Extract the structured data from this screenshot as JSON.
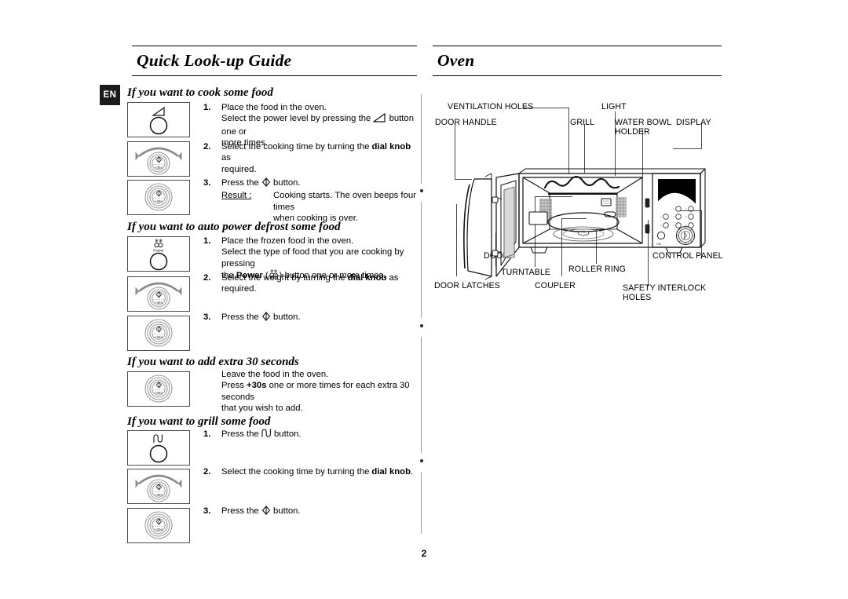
{
  "page_number": "2",
  "language_badge": "EN",
  "columns": {
    "left_title": "Quick Look-up Guide",
    "right_title": "Oven"
  },
  "sections": [
    {
      "id": "cook",
      "heading": "If you want to cook some food",
      "steps": [
        {
          "num": "1.",
          "icon": "power-level-button",
          "lines": [
            "Place the food in the oven.",
            "Select the power level by pressing the [power-icon] button one or more times."
          ],
          "text_a": "Place the food in the oven.",
          "text_b_pre": "Select the power level by pressing the",
          "text_b_post": "button one or",
          "text_c": "more times."
        },
        {
          "num": "2.",
          "icon": "dial-knob-turn",
          "text_pre": "Select the cooking time by turning the",
          "text_bold": "dial knob",
          "text_post": "as",
          "text_next": "required."
        },
        {
          "num": "3.",
          "icon": "dial-knob-press",
          "text_pre": "Press the",
          "text_post": "button.",
          "result_label": "Result :",
          "result_line1": "Cooking starts. The oven beeps four times",
          "result_line2": "when cooking is over."
        }
      ]
    },
    {
      "id": "defrost",
      "heading": "If you want to auto power defrost some food",
      "steps": [
        {
          "num": "1.",
          "icon": "power-defrost-button",
          "text_a": "Place the frozen food in the oven.",
          "text_b": "Select the type of food that you are cooking by pressing",
          "text_c_pre": "the",
          "text_c_bold": "Power",
          "text_c_paren_open": "(",
          "text_c_paren_close": ")",
          "text_c_post": "button one or more times."
        },
        {
          "num": "2.",
          "icon": "dial-knob-turn",
          "text_pre": "Select the weight by turning the",
          "text_bold": "dial knob",
          "text_post": "as required."
        },
        {
          "num": "3.",
          "icon": "dial-knob-press",
          "text_pre": "Press the",
          "text_post": "button."
        }
      ]
    },
    {
      "id": "extra30",
      "heading": "If you want to add extra 30 seconds",
      "steps": [
        {
          "num": "",
          "icon": "dial-knob-press",
          "text_a": "Leave the food in the oven.",
          "text_b_pre": "Press",
          "text_b_bold": "+30s",
          "text_b_post": "one or more times for each extra 30 seconds",
          "text_c": "that you wish to add."
        }
      ]
    },
    {
      "id": "grill",
      "heading": "If you want to grill some food",
      "steps": [
        {
          "num": "1.",
          "icon": "grill-button",
          "text_pre": "Press the",
          "text_post": "button."
        },
        {
          "num": "2.",
          "icon": "dial-knob-turn",
          "text_pre": "Select the cooking time by turning the",
          "text_bold": "dial knob",
          "text_post": "."
        },
        {
          "num": "3.",
          "icon": "dial-knob-press",
          "text_pre": "Press the",
          "text_post": "button."
        }
      ]
    }
  ],
  "diagram": {
    "name": "microwave-oven-exploded-view",
    "labels": [
      {
        "id": "ventilation-holes",
        "text": "VENTILATION HOLES"
      },
      {
        "id": "light",
        "text": "LIGHT"
      },
      {
        "id": "grill",
        "text": "GRILL"
      },
      {
        "id": "water-bowl-holder-line1",
        "text": "WATER BOWL"
      },
      {
        "id": "water-bowl-holder-line2",
        "text": "HOLDER"
      },
      {
        "id": "display",
        "text": "DISPLAY"
      },
      {
        "id": "door-handle",
        "text": "DOOR HANDLE"
      },
      {
        "id": "door",
        "text": "DOOR"
      },
      {
        "id": "turntable",
        "text": "TURNTABLE"
      },
      {
        "id": "roller-ring",
        "text": "ROLLER RING"
      },
      {
        "id": "control-panel",
        "text": "CONTROL PANEL"
      },
      {
        "id": "door-latches",
        "text": "DOOR LATCHES"
      },
      {
        "id": "coupler",
        "text": "COUPLER"
      },
      {
        "id": "safety-interlock-holes-line1",
        "text": "SAFETY INTERLOCK"
      },
      {
        "id": "safety-interlock-holes-line2",
        "text": "HOLES"
      }
    ]
  },
  "icon_labels": {
    "power_text": "Power",
    "plus30s_text": "+30s"
  },
  "colors": {
    "ink": "#000000",
    "line_gray": "#4a4a4a",
    "badge_bg": "#1b1b1b",
    "panel_black": "#000000"
  }
}
